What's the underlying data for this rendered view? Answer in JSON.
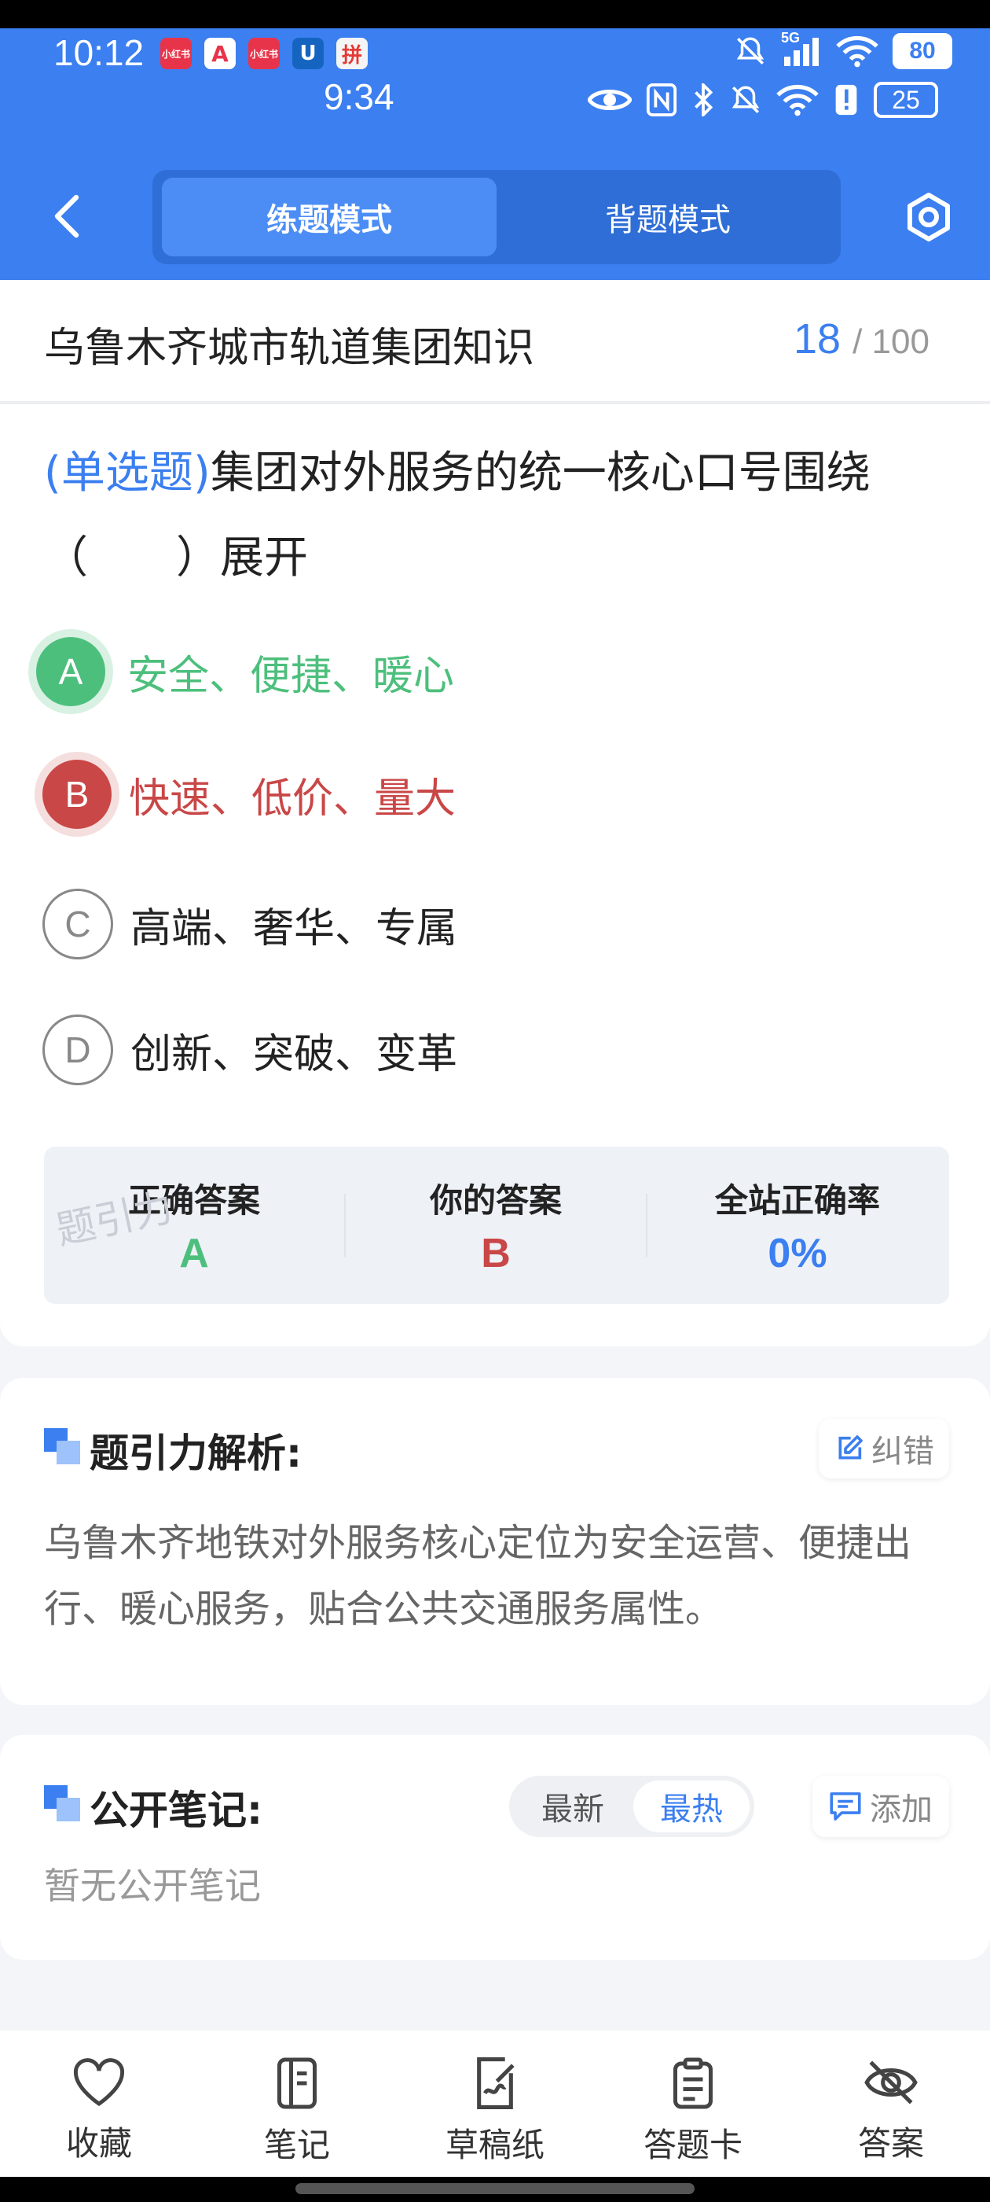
{
  "status_bar": {
    "time": "10:12",
    "time_secondary": "9:34",
    "signal_label": "5G",
    "battery": "80",
    "battery_secondary": "25",
    "app_icons": [
      "小红书",
      "A",
      "小红书",
      "U",
      "拼"
    ]
  },
  "header": {
    "back_icon": "chevron-left-icon",
    "mode_active": "练题模式",
    "mode_inactive": "背题模式",
    "settings_icon": "hexagon-settings-icon"
  },
  "question_header": {
    "bank_title": "乌鲁木齐城市轨道集团知识",
    "current": "18",
    "total_text": "/ 100"
  },
  "question": {
    "type_label": "(单选题)",
    "text_line1": "集团对外服务的统一核心口号围绕",
    "text_line2": "（　　）展开",
    "options": [
      {
        "letter": "A",
        "text": "安全、便捷、暖心",
        "state": "correct"
      },
      {
        "letter": "B",
        "text": "快速、低价、量大",
        "state": "wrong"
      },
      {
        "letter": "C",
        "text": "高端、奢华、专属",
        "state": "normal"
      },
      {
        "letter": "D",
        "text": "创新、突破、变革",
        "state": "normal"
      }
    ]
  },
  "stats": {
    "correct_label": "正确答案",
    "correct_value": "A",
    "yours_label": "你的答案",
    "yours_value": "B",
    "rate_label": "全站正确率",
    "rate_value": "0%",
    "watermark": "题引力"
  },
  "analysis": {
    "title": "题引力解析:",
    "correct_button": "纠错",
    "text": "乌鲁木齐地铁对外服务核心定位为安全运营、便捷出行、暖心服务，贴合公共交通服务属性。"
  },
  "notes": {
    "title": "公开笔记:",
    "sort_latest": "最新",
    "sort_hot": "最热",
    "add_button": "添加",
    "empty_text": "暂无公开笔记"
  },
  "bottom_nav": [
    {
      "label": "收藏",
      "icon": "heart-icon"
    },
    {
      "label": "笔记",
      "icon": "notebook-icon"
    },
    {
      "label": "草稿纸",
      "icon": "draft-paper-icon"
    },
    {
      "label": "答题卡",
      "icon": "answer-card-icon"
    },
    {
      "label": "答案",
      "icon": "eye-off-icon"
    }
  ],
  "colors": {
    "brand_blue": "#3b7ff0",
    "correct_green": "#4dbf7c",
    "wrong_red": "#c94747"
  }
}
